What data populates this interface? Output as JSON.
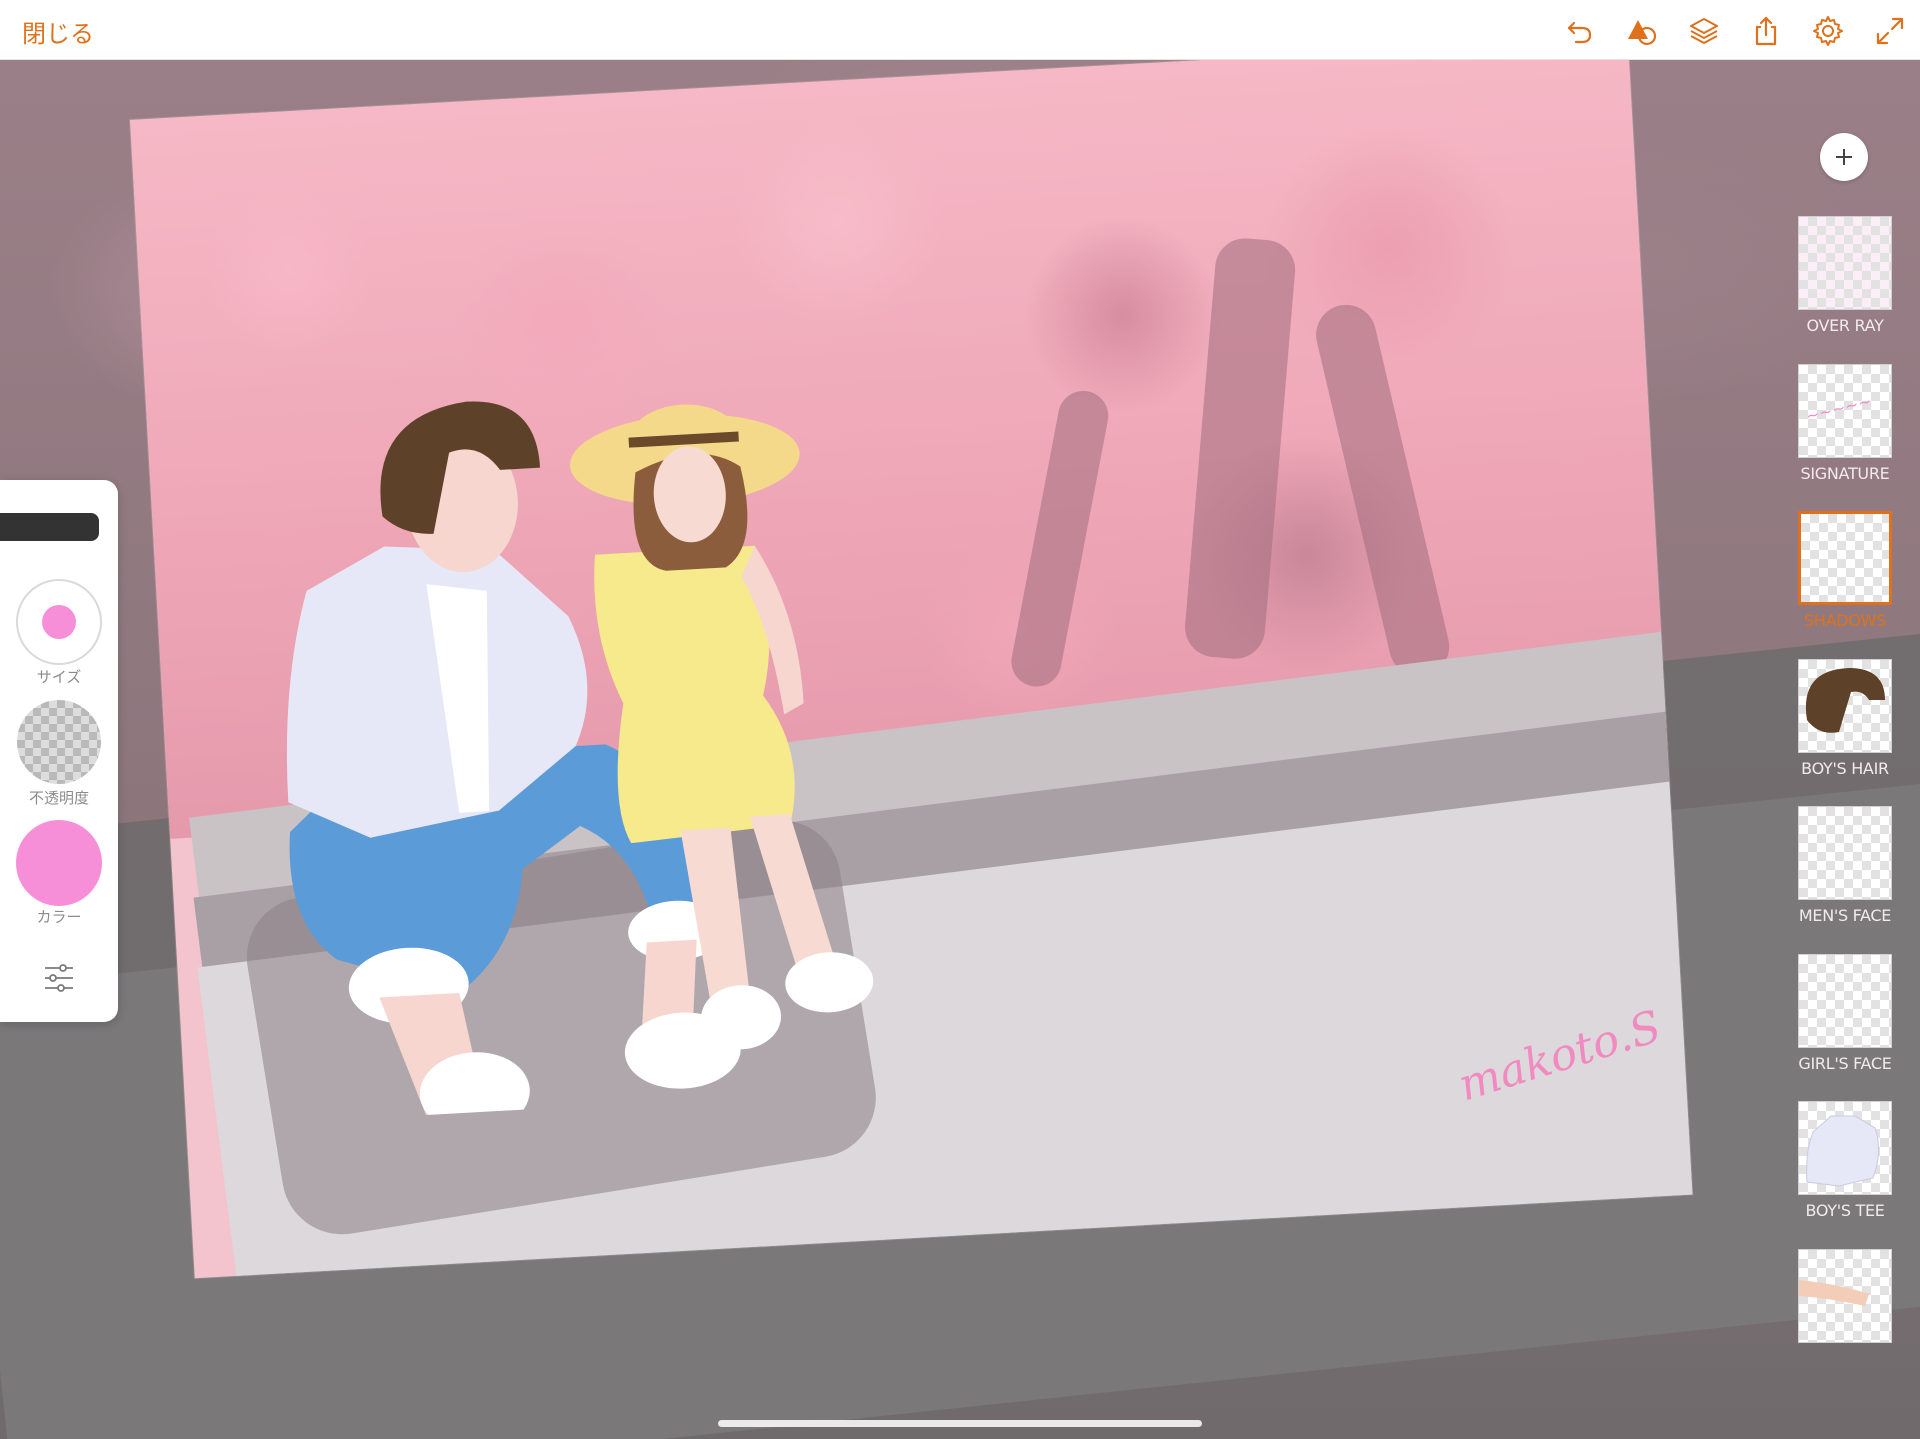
{
  "topbar": {
    "close_label": "閉じる",
    "icons": [
      "undo-icon",
      "shape-icon",
      "layers-icon",
      "share-icon",
      "settings-icon",
      "fullscreen-icon"
    ],
    "accent_color": "#e0711c"
  },
  "tools": {
    "size_label": "サイズ",
    "opacity_label": "不透明度",
    "color_label": "カラー",
    "brush_color": "#f68fd8"
  },
  "artwork": {
    "signature": "makoto.S"
  },
  "layers": [
    {
      "name": "OVER RAY",
      "selected": false
    },
    {
      "name": "SIGNATURE",
      "selected": false
    },
    {
      "name": "SHADOWS",
      "selected": true
    },
    {
      "name": "BOY'S HAIR",
      "selected": false
    },
    {
      "name": "MEN'S FACE",
      "selected": false
    },
    {
      "name": "GIRL'S FACE",
      "selected": false
    },
    {
      "name": "BOY'S TEE",
      "selected": false
    },
    {
      "name": "",
      "selected": false
    }
  ]
}
